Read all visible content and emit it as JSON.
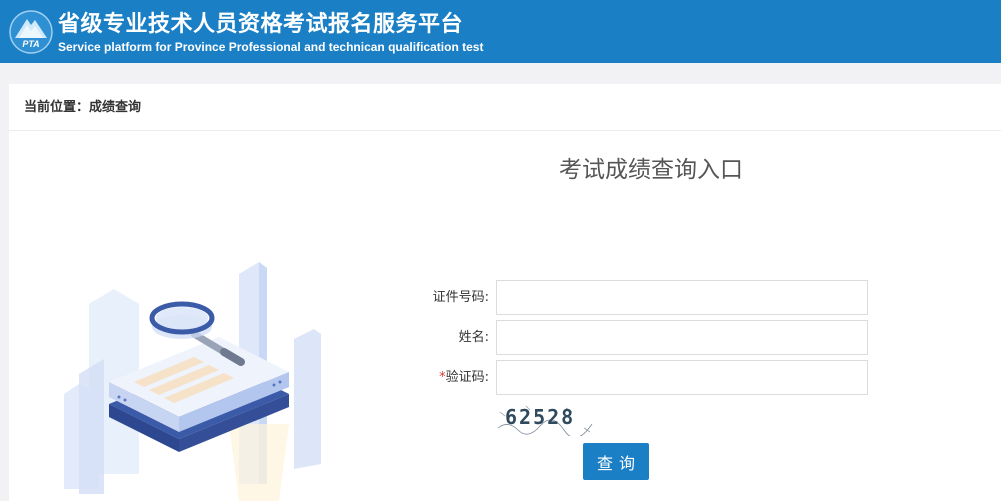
{
  "header": {
    "title": "省级专业技术人员资格考试报名服务平台",
    "subtitle": "Service platform for Province Professional and technican qualification test",
    "logo_text": "PTA",
    "background_color": "#1b7fc5"
  },
  "breadcrumb": {
    "text": "当前位置：成绩查询"
  },
  "page": {
    "title": "考试成绩查询入口"
  },
  "form": {
    "id_number": {
      "label": "证件号码:",
      "value": "",
      "placeholder": ""
    },
    "name": {
      "label": "姓名:",
      "value": "",
      "placeholder": ""
    },
    "captcha": {
      "required_mark": "*",
      "label": "验证码:",
      "value": "",
      "placeholder": ""
    },
    "captcha_image_text": "62528",
    "submit_label": "查询"
  },
  "colors": {
    "accent": "#1b7fc5",
    "required": "#e53935"
  }
}
